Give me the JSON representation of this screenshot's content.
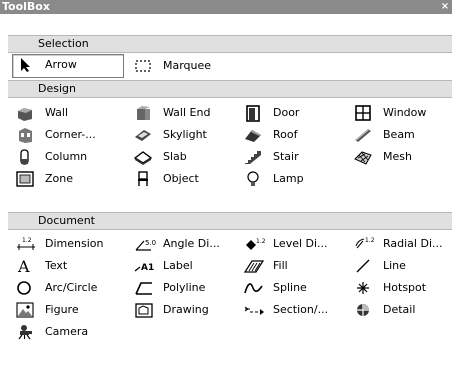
{
  "window": {
    "title": "ToolBox",
    "close_glyph": "×"
  },
  "sections": {
    "selection": "Selection",
    "design": "Design",
    "document": "Document"
  },
  "selection_tools": [
    {
      "label": "Arrow",
      "icon": "arrow-icon",
      "selected": true
    },
    {
      "label": "Marquee",
      "icon": "marquee-icon"
    }
  ],
  "design_tools": [
    {
      "label": "Wall",
      "icon": "wall-icon"
    },
    {
      "label": "Wall End",
      "icon": "wall-end-icon"
    },
    {
      "label": "Door",
      "icon": "door-icon"
    },
    {
      "label": "Window",
      "icon": "window-icon"
    },
    {
      "label": "Corner-...",
      "icon": "corner-window-icon"
    },
    {
      "label": "Skylight",
      "icon": "skylight-icon"
    },
    {
      "label": "Roof",
      "icon": "roof-icon"
    },
    {
      "label": "Beam",
      "icon": "beam-icon"
    },
    {
      "label": "Column",
      "icon": "column-icon"
    },
    {
      "label": "Slab",
      "icon": "slab-icon"
    },
    {
      "label": "Stair",
      "icon": "stair-icon"
    },
    {
      "label": "Mesh",
      "icon": "mesh-icon"
    },
    {
      "label": "Zone",
      "icon": "zone-icon"
    },
    {
      "label": "Object",
      "icon": "object-icon"
    },
    {
      "label": "Lamp",
      "icon": "lamp-icon"
    }
  ],
  "document_tools": [
    {
      "label": "Dimension",
      "icon": "dimension-icon"
    },
    {
      "label": "Angle Di...",
      "icon": "angle-dimension-icon"
    },
    {
      "label": "Level Di...",
      "icon": "level-dimension-icon"
    },
    {
      "label": "Radial Di...",
      "icon": "radial-dimension-icon"
    },
    {
      "label": "Text",
      "icon": "text-icon"
    },
    {
      "label": "Label",
      "icon": "label-icon"
    },
    {
      "label": "Fill",
      "icon": "fill-icon"
    },
    {
      "label": "Line",
      "icon": "line-icon"
    },
    {
      "label": "Arc/Circle",
      "icon": "arc-circle-icon"
    },
    {
      "label": "Polyline",
      "icon": "polyline-icon"
    },
    {
      "label": "Spline",
      "icon": "spline-icon"
    },
    {
      "label": "Hotspot",
      "icon": "hotspot-icon"
    },
    {
      "label": "Figure",
      "icon": "figure-icon"
    },
    {
      "label": "Drawing",
      "icon": "drawing-icon"
    },
    {
      "label": "Section/...",
      "icon": "section-elevation-icon"
    },
    {
      "label": "Detail",
      "icon": "detail-icon"
    },
    {
      "label": "Camera",
      "icon": "camera-icon"
    }
  ],
  "icon_glyphs": {
    "text": "A",
    "label": "A1",
    "dimension": "1.2",
    "angle": "5.0",
    "level": "1.2",
    "radial": "1.2"
  },
  "colors": {
    "titlebar": "#8a8a8a",
    "section_header": "#e0e0e0",
    "selected_border": "#7a7a7a"
  }
}
